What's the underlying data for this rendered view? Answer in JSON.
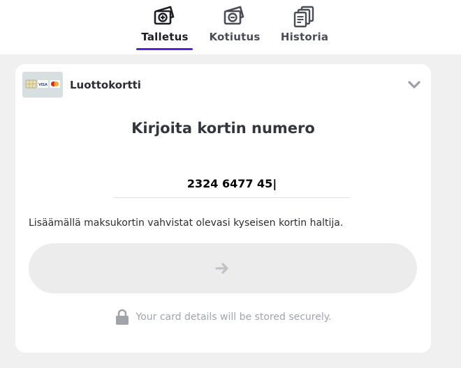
{
  "tabs": [
    {
      "label": "Talletus",
      "icon": "wallet-plus-icon",
      "active": true
    },
    {
      "label": "Kotiutus",
      "icon": "wallet-minus-icon",
      "active": false
    },
    {
      "label": "Historia",
      "icon": "history-pages-icon",
      "active": false
    }
  ],
  "payment_method": {
    "label": "Luottokortti",
    "logo_text": {
      "visa": "VISA"
    }
  },
  "card_form": {
    "title": "Kirjoita kortin numero",
    "card_number_value": "2324 6477 45|",
    "consent_text": "Lisäämällä maksukortin vahvistat olevasi kyseisen kortin haltija.",
    "submit_icon": "arrow-right-icon",
    "secure_text": "Your card details will be stored securely."
  },
  "colors": {
    "accent": "#5b1fd6",
    "page_bg": "#f0f0f1",
    "button_bg": "#ececed",
    "muted_text": "#a0a4ab"
  }
}
